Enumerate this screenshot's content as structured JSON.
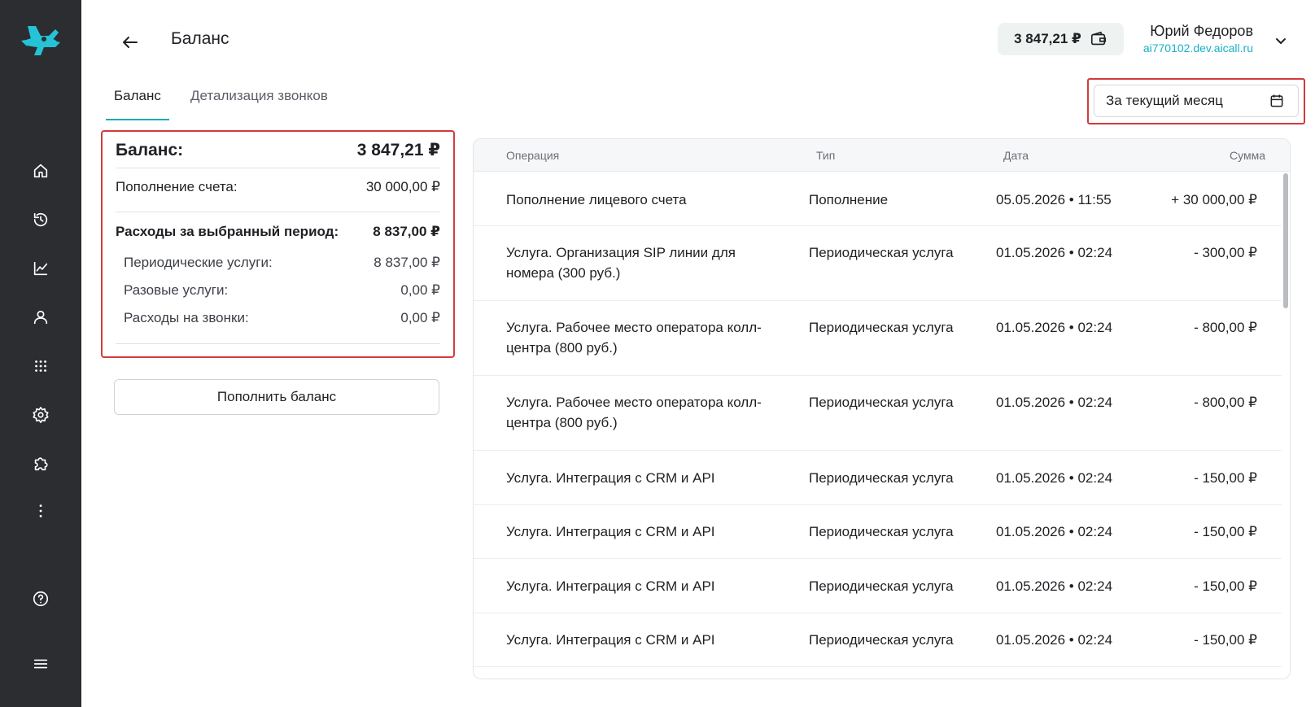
{
  "header": {
    "title": "Баланс",
    "balance_chip": "3 847,21 ₽",
    "user_name": "Юрий Федоров",
    "user_domain": "ai770102.dev.aicall.ru"
  },
  "icons": {
    "logo": "app-logo",
    "nav": [
      "home-icon",
      "history-icon",
      "analytics-icon",
      "user-icon",
      "dialpad-icon",
      "settings-icon",
      "puzzle-icon",
      "more-icon",
      "help-icon",
      "menu-icon"
    ]
  },
  "colors": {
    "sidebar": "#2c2d30",
    "accent": "#19b1c4",
    "highlight": "#d23b3b"
  },
  "tabs": [
    {
      "label": "Баланс",
      "active": true
    },
    {
      "label": "Детализация звонков",
      "active": false
    }
  ],
  "period": {
    "label": "За текущий месяц"
  },
  "summary": {
    "balance_label": "Баланс:",
    "balance_value": "3 847,21 ₽",
    "topup_label": "Пополнение счета:",
    "topup_value": "30 000,00 ₽",
    "expenses_label": "Расходы за выбранный период:",
    "expenses_value": "8 837,00 ₽",
    "periodic_label": "Периодические услуги:",
    "periodic_value": "8 837,00 ₽",
    "oneoff_label": "Разовые услуги:",
    "oneoff_value": "0,00 ₽",
    "calls_label": "Расходы на звонки:",
    "calls_value": "0,00 ₽"
  },
  "topup_button": "Пополнить баланс",
  "table": {
    "columns": [
      "Операция",
      "Тип",
      "Дата",
      "Сумма"
    ],
    "rows": [
      {
        "operation": "Пополнение лицевого счета",
        "type": "Пополнение",
        "date": "05.05.2026 • 11:55",
        "amount": "+ 30 000,00 ₽"
      },
      {
        "operation": "Услуга. Организация SIP линии для номера (300 руб.)",
        "type": "Периодическая услуга",
        "date": "01.05.2026 • 02:24",
        "amount": "- 300,00 ₽"
      },
      {
        "operation": "Услуга. Рабочее место оператора колл-центра (800 руб.)",
        "type": "Периодическая услуга",
        "date": "01.05.2026 • 02:24",
        "amount": "- 800,00 ₽"
      },
      {
        "operation": "Услуга. Рабочее место оператора колл-центра (800 руб.)",
        "type": "Периодическая услуга",
        "date": "01.05.2026 • 02:24",
        "amount": "- 800,00 ₽"
      },
      {
        "operation": "Услуга. Интеграция с CRM и API",
        "type": "Периодическая услуга",
        "date": "01.05.2026 • 02:24",
        "amount": "- 150,00 ₽"
      },
      {
        "operation": "Услуга. Интеграция с CRM и API",
        "type": "Периодическая услуга",
        "date": "01.05.2026 • 02:24",
        "amount": "- 150,00 ₽"
      },
      {
        "operation": "Услуга. Интеграция с CRM и API",
        "type": "Периодическая услуга",
        "date": "01.05.2026 • 02:24",
        "amount": "- 150,00 ₽"
      },
      {
        "operation": "Услуга. Интеграция с CRM и API",
        "type": "Периодическая услуга",
        "date": "01.05.2026 • 02:24",
        "amount": "- 150,00 ₽"
      }
    ]
  }
}
